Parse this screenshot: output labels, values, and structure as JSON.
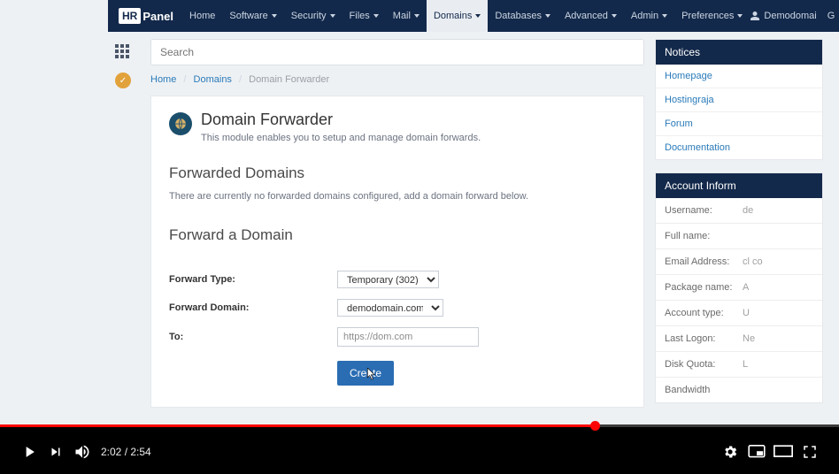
{
  "brand": {
    "prefix": "HR",
    "suffix": "Panel"
  },
  "nav": [
    {
      "label": "Home",
      "dropdown": false,
      "active": false
    },
    {
      "label": "Software",
      "dropdown": true,
      "active": false
    },
    {
      "label": "Security",
      "dropdown": true,
      "active": false
    },
    {
      "label": "Files",
      "dropdown": true,
      "active": false
    },
    {
      "label": "Mail",
      "dropdown": true,
      "active": false
    },
    {
      "label": "Domains",
      "dropdown": true,
      "active": true
    },
    {
      "label": "Databases",
      "dropdown": true,
      "active": false
    },
    {
      "label": "Advanced",
      "dropdown": true,
      "active": false
    },
    {
      "label": "Admin",
      "dropdown": true,
      "active": false
    },
    {
      "label": "Preferences",
      "dropdown": true,
      "active": false
    }
  ],
  "user": {
    "name": "Demodomai",
    "refresh": "G"
  },
  "search": {
    "placeholder": "Search"
  },
  "breadcrumb": {
    "home": "Home",
    "domains": "Domains",
    "current": "Domain Forwarder",
    "sep": "/"
  },
  "module": {
    "title": "Domain Forwarder",
    "desc": "This module enables you to setup and manage domain forwards."
  },
  "sections": {
    "list_title": "Forwarded Domains",
    "list_desc": "There are currently no forwarded domains configured, add a domain forward below.",
    "form_title": "Forward a Domain"
  },
  "form": {
    "type_label": "Forward Type:",
    "type_value": "Temporary (302)",
    "domain_label": "Forward Domain:",
    "domain_value": "demodomain.com",
    "to_label": "To:",
    "to_value": "https://dom.com",
    "submit": "Create"
  },
  "notices": {
    "title": "Notices",
    "items": [
      "Homepage",
      "Hostingraja",
      "Forum",
      "Documentation"
    ]
  },
  "account": {
    "title": "Account Inform",
    "rows": [
      {
        "lbl": "Username:",
        "val": "de"
      },
      {
        "lbl": "Full name:",
        "val": ""
      },
      {
        "lbl": "Email Address:",
        "val": "cl\nco"
      },
      {
        "lbl": "Package name:",
        "val": "A"
      },
      {
        "lbl": "Account type:",
        "val": "U"
      },
      {
        "lbl": "Last Logon:",
        "val": "Ne"
      },
      {
        "lbl": "Disk Quota:",
        "val": "L"
      },
      {
        "lbl": "Bandwidth",
        "val": ""
      }
    ]
  },
  "video": {
    "current": "2:02",
    "duration": "2:54",
    "sep": " / ",
    "progress_pct": 70.9
  }
}
